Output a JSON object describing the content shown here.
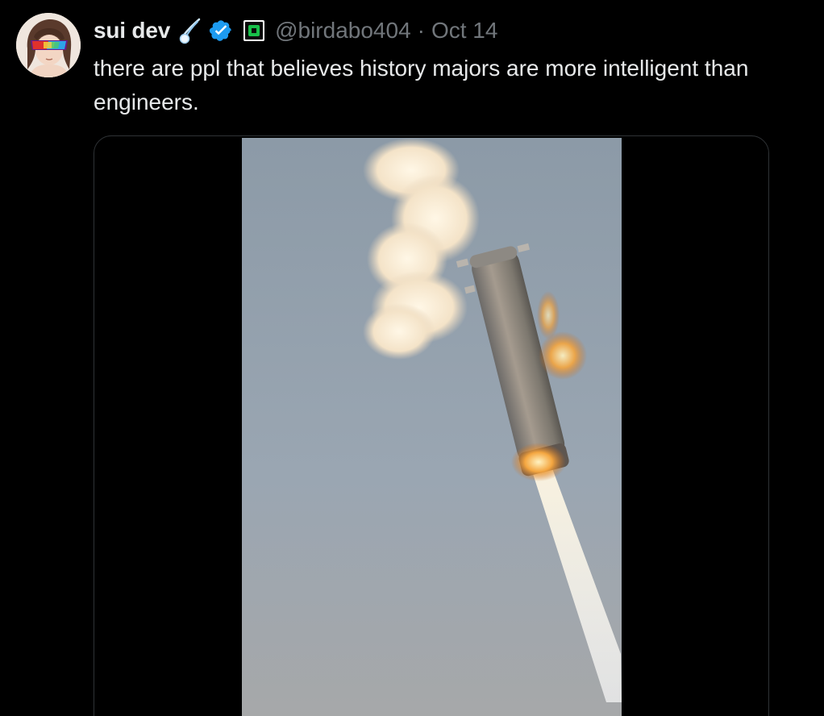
{
  "tweet": {
    "author": {
      "display_name": "sui dev",
      "handle": "@birdabo404",
      "verified": true,
      "emoji_icon": "comet-icon",
      "affiliate_icon": "affiliate-badge-icon"
    },
    "separator": "·",
    "date": "Oct 14",
    "text": "there are ppl that believes history majors are more intelligent than engineers.",
    "media": {
      "type": "video",
      "subject": "rocket-booster-in-flight"
    }
  },
  "colors": {
    "background": "#000000",
    "primary_text": "#e7e9ea",
    "secondary_text": "#71767b",
    "verified_blue": "#1d9bf0",
    "media_border": "#2f3336"
  }
}
